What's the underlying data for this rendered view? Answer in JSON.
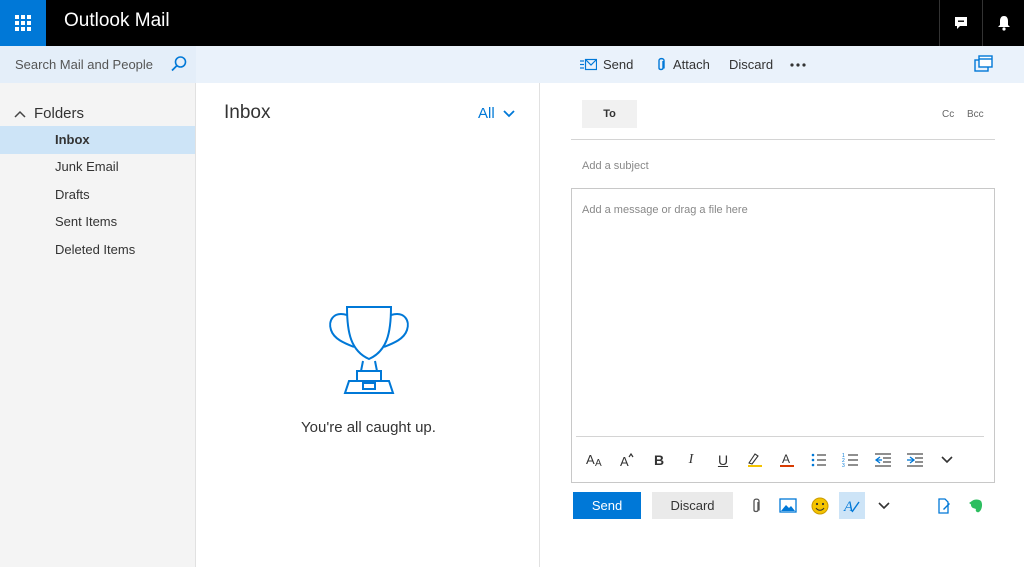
{
  "app": {
    "title": "Outlook Mail"
  },
  "search": {
    "placeholder": "Search Mail and People"
  },
  "commands": {
    "send": "Send",
    "attach": "Attach",
    "discard": "Discard"
  },
  "nav": {
    "folders_label": "Folders",
    "folders": [
      {
        "label": "Inbox",
        "selected": true
      },
      {
        "label": "Junk Email",
        "selected": false
      },
      {
        "label": "Drafts",
        "selected": false
      },
      {
        "label": "Sent Items",
        "selected": false
      },
      {
        "label": "Deleted Items",
        "selected": false
      }
    ]
  },
  "list": {
    "title": "Inbox",
    "filter": "All",
    "empty_message": "You're all caught up."
  },
  "compose": {
    "to_label": "To",
    "cc_label": "Cc",
    "bcc_label": "Bcc",
    "subject_placeholder": "Add a subject",
    "body_placeholder": "Add a message or drag a file here",
    "send_label": "Send",
    "discard_label": "Discard"
  },
  "colors": {
    "accent": "#0078d7",
    "topbar": "#000000",
    "selected": "#cde4f7",
    "emoji": "#f5c400",
    "evernote": "#2dbe60"
  },
  "icons": [
    "app-launcher-icon",
    "chat-icon",
    "bell-icon",
    "search-icon",
    "send-icon",
    "paperclip-icon",
    "more-icon",
    "popout-icon",
    "chevron-up-icon",
    "chevron-down-icon",
    "trophy-icon"
  ]
}
